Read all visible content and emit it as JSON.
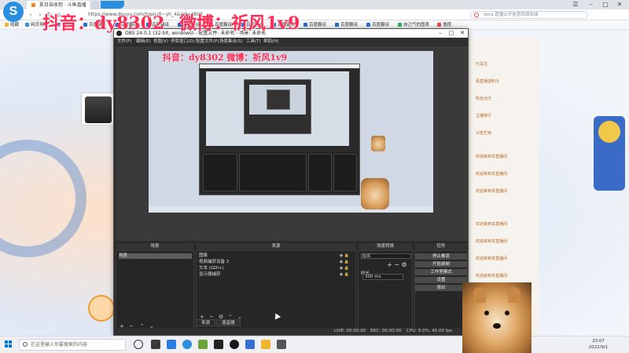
{
  "browser": {
    "active_tab": "夏日自收到 · 斗鱼直播",
    "url": "https://www.douyu.com/topic/0~yh_4&rid=4803",
    "search_placeholder": "Sora 直播公开信息阳源加油",
    "bookmarks": [
      "收藏",
      "网页导航",
      "1-33G",
      "百度翻译",
      "百度翻译",
      "百度翻译",
      "百度翻译",
      "百度翻译",
      "百度翻译",
      "百度翻译",
      "百度翻译",
      "百度翻译",
      "百度翻译",
      "自己气的图表",
      "逸程"
    ],
    "nav": {
      "back": "‹",
      "forward": "›",
      "refresh": "↻",
      "home": "⌂"
    }
  },
  "watermark": {
    "line1": "抖音：dy8302",
    "line2": "微博：祈风1v9",
    "inner": "抖音：dy8302  微博：祈风1v9"
  },
  "obs": {
    "title": "OBS 24.0.1 (32-bit, windows) - 配置文件: 未命名 - 场景: 未命名",
    "menu": [
      "文件(F)",
      "编辑(E)",
      "视图(V)",
      "停靠窗口(D)",
      "配置文件(P)",
      "场景集合(S)",
      "工具(T)",
      "帮助(H)"
    ],
    "scenes": {
      "title": "场景",
      "items": [
        "场景"
      ]
    },
    "sources": {
      "title": "来源",
      "items": [
        "图像",
        "视频捕获设备 2",
        "文本 (GDI+)",
        "显示器捕获"
      ]
    },
    "mixer": {
      "title": "场景转换",
      "transition": "淡出",
      "duration_label": "时长",
      "duration": "300 ms"
    },
    "controls": {
      "title": "控件",
      "buttons": [
        "停止推流",
        "开始录制",
        "工作室模式",
        "设置",
        "退出"
      ]
    },
    "tabs": [
      "来源",
      "混音器"
    ],
    "status": {
      "live": "LIVE: 00:00:00",
      "rec": "REC: 00:00:00",
      "cpu": "CPU: 9.0%, 45.00 fps"
    }
  },
  "page": {
    "side_rows": [
      "已关注",
      "看直播送积分",
      "粉丝大厅",
      "主播排行",
      "公告栏目",
      "欢迎来到本直播间",
      "欢迎来到本直播间",
      "欢迎来到本直播间",
      "欢迎来到本直播间",
      "欢迎来到本直播间",
      "欢迎来到本直播间",
      "欢迎来到本直播间"
    ]
  },
  "taskbar": {
    "search_placeholder": "在这里输入你要搜索的内容",
    "time": "23:07",
    "date": "2022/9/1"
  },
  "colors": {
    "accent": "#2b8fe0",
    "watermark": "#ff2d55",
    "obs_bg": "#2a2a2a"
  }
}
